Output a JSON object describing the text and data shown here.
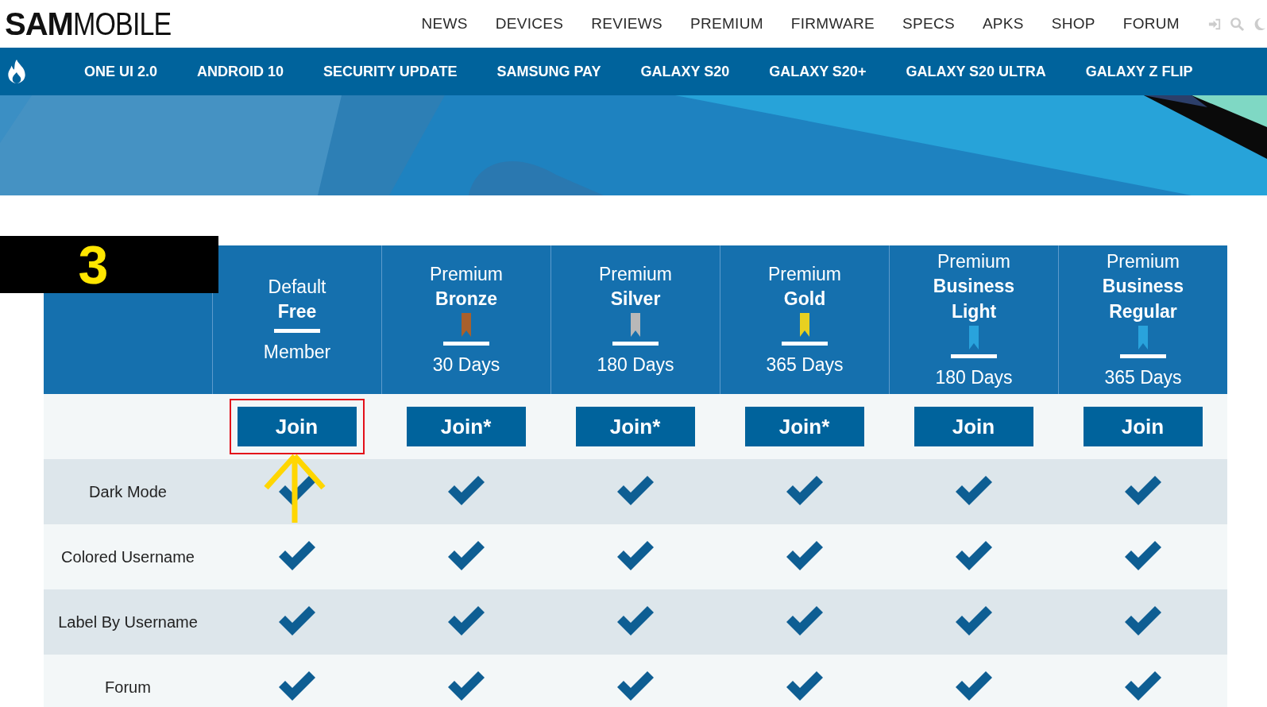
{
  "logo": {
    "bold": "SAM",
    "light": "MOBILE"
  },
  "main_nav": [
    "NEWS",
    "DEVICES",
    "REVIEWS",
    "PREMIUM",
    "FIRMWARE",
    "SPECS",
    "APKS",
    "SHOP",
    "FORUM"
  ],
  "sub_nav": [
    "ONE UI 2.0",
    "ANDROID 10",
    "SECURITY UPDATE",
    "SAMSUNG PAY",
    "GALAXY S20",
    "GALAXY S20+",
    "GALAXY S20 ULTRA",
    "GALAXY Z FLIP"
  ],
  "annotation": {
    "label": "3"
  },
  "plans": [
    {
      "top": "Default",
      "name": [
        "Free"
      ],
      "duration": "Member",
      "join": "Join",
      "highlighted": true
    },
    {
      "top": "Premium",
      "name": [
        "Bronze"
      ],
      "color": "#a8602c",
      "duration": "30 Days",
      "join": "Join*",
      "highlighted": false
    },
    {
      "top": "Premium",
      "name": [
        "Silver"
      ],
      "color": "#b8b8b8",
      "duration": "180 Days",
      "join": "Join*",
      "highlighted": false
    },
    {
      "top": "Premium",
      "name": [
        "Gold"
      ],
      "color": "#e8d020",
      "duration": "365 Days",
      "join": "Join*",
      "highlighted": false
    },
    {
      "top": "Premium",
      "name": [
        "Business",
        "Light"
      ],
      "color": "#29a3dc",
      "duration": "180 Days",
      "join": "Join",
      "highlighted": false
    },
    {
      "top": "Premium",
      "name": [
        "Business",
        "Regular"
      ],
      "color": "#29a3dc",
      "duration": "365 Days",
      "join": "Join",
      "highlighted": false
    }
  ],
  "features": [
    {
      "name": "Dark Mode",
      "checks": [
        true,
        true,
        true,
        true,
        true,
        true
      ]
    },
    {
      "name": "Colored Username",
      "checks": [
        true,
        true,
        true,
        true,
        true,
        true
      ]
    },
    {
      "name": "Label By Username",
      "checks": [
        true,
        true,
        true,
        true,
        true,
        true
      ]
    },
    {
      "name": "Forum",
      "checks": [
        true,
        true,
        true,
        true,
        true,
        true
      ]
    }
  ]
}
